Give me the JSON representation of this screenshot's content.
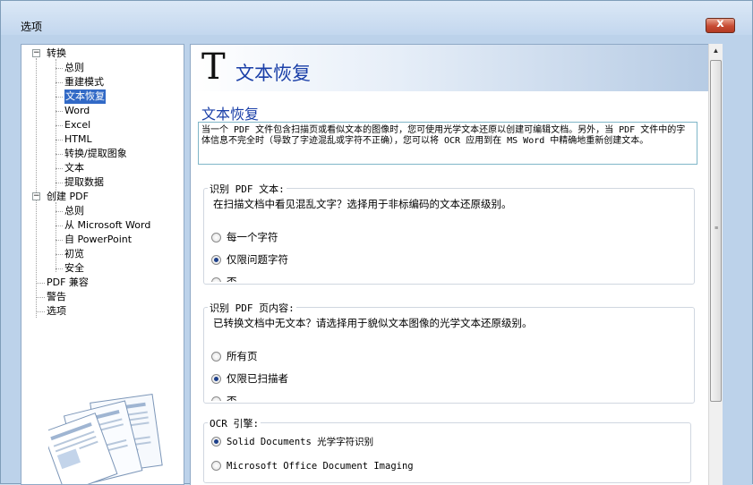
{
  "window": {
    "title": "选项",
    "close_label": "x"
  },
  "tree": {
    "items": [
      {
        "label": "转换",
        "expander": "−"
      },
      {
        "label": "总则"
      },
      {
        "label": "重建模式"
      },
      {
        "label": "文本恢复"
      },
      {
        "label": "Word"
      },
      {
        "label": "Excel"
      },
      {
        "label": "HTML"
      },
      {
        "label": "转换/提取图象"
      },
      {
        "label": "文本"
      },
      {
        "label": "提取数据"
      },
      {
        "label": "创建 PDF",
        "expander": "−"
      },
      {
        "label": "总则"
      },
      {
        "label": "从 Microsoft Word"
      },
      {
        "label": "自 PowerPoint"
      },
      {
        "label": "初览"
      },
      {
        "label": "安全"
      },
      {
        "label": "PDF 兼容"
      },
      {
        "label": "警告"
      },
      {
        "label": "选项"
      }
    ],
    "selected": "文本恢复"
  },
  "content": {
    "header_icon": "T",
    "header_title": "文本恢复",
    "section_title": "文本恢复",
    "description": "当一个 PDF 文件包含扫描页或看似文本的图像时，您可使用光学文本还原以创建可编辑文档。另外，当 PDF 文件中的字体信息不完全时（导致了字迹混乱或字符不正确），您可以将 OCR 应用到在 MS Word 中精确地重新创建文本。",
    "group1": {
      "legend": "识别 PDF 文本:",
      "desc": "在扫描文档中看见混乱文字？选择用于非标编码的文本还原级别。",
      "options": [
        "每一个字符",
        "仅限问题字符",
        "否"
      ],
      "selected_index": 1
    },
    "group2": {
      "legend": "识别 PDF 页内容:",
      "desc": "已转换文档中无文本？请选择用于貌似文本图像的光学文本还原级别。",
      "options": [
        "所有页",
        "仅限已扫描者",
        "否"
      ],
      "selected_index": 1
    },
    "group3": {
      "legend": "OCR 引擎:",
      "options": [
        "Solid Documents 光学字符识别",
        "Microsoft Office Document Imaging"
      ],
      "selected_index": 0
    }
  },
  "scrollbar": {
    "up_icon": "▲",
    "down_icon": "▼",
    "grip": "≡"
  }
}
